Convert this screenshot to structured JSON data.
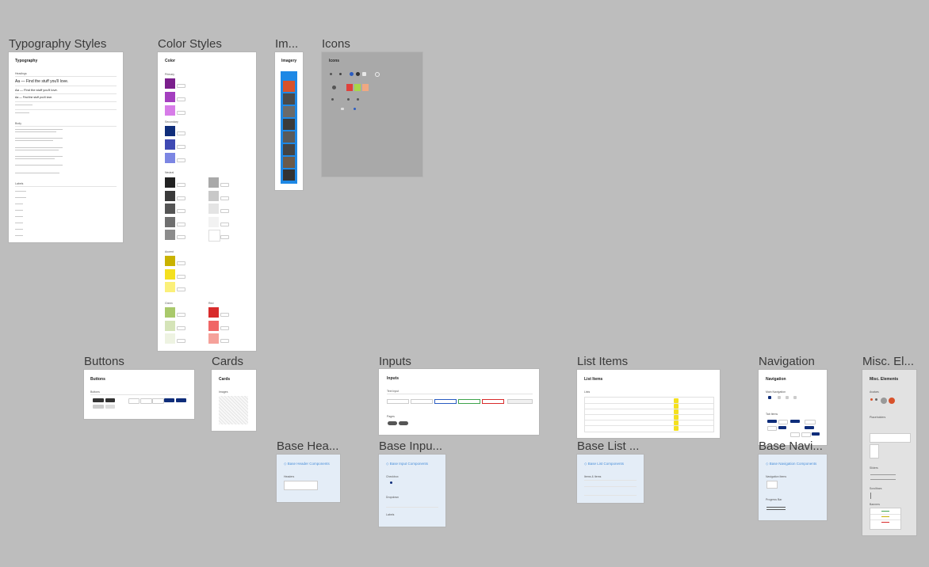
{
  "frames": {
    "typography": {
      "title": "Typography Styles",
      "heading": "Typography",
      "sections": [
        "Headings",
        "Body",
        "Labels"
      ],
      "samples": [
        "Aa — Find the stuff you'll love.",
        "Aa — Find the stuff you'll love.",
        "Aa — Find the stuff you'll love."
      ]
    },
    "color": {
      "title": "Color Styles",
      "heading": "Color",
      "groups": [
        "Primary",
        "Secondary",
        "Neutral",
        "Accent",
        "Green",
        "Red"
      ]
    },
    "imagery": {
      "title": "Im...",
      "heading": "Imagery"
    },
    "icons": {
      "title": "Icons",
      "heading": "Icons"
    },
    "buttons": {
      "title": "Buttons",
      "heading": "Buttons",
      "group": "Buttons"
    },
    "cards": {
      "title": "Cards",
      "heading": "Cards",
      "group": "Images"
    },
    "inputs": {
      "title": "Inputs",
      "heading": "Inputs",
      "group1": "Text Input",
      "group2": "Pages"
    },
    "list_items": {
      "title": "List Items",
      "heading": "List Items",
      "group": "Lists"
    },
    "navigation": {
      "title": "Navigation",
      "heading": "Navigation",
      "group1": "Main Navigation",
      "group2": "Tab Items"
    },
    "misc": {
      "title": "Misc. El...",
      "heading": "Misc. Elements",
      "group1": "Avatars",
      "group2": "Placeholders",
      "group3": "Sliders",
      "group4": "Scrollbars",
      "group5": "Banners"
    },
    "base_header": {
      "title": "Base Hea...",
      "link": "◇ Base Header Components",
      "group": "Headers"
    },
    "base_input": {
      "title": "Base Inpu...",
      "link": "◇ Base Input Components",
      "group1": "Checkbox",
      "group2": "Dropdown",
      "group3": "Labels"
    },
    "base_list": {
      "title": "Base List ...",
      "link": "◇ Base List Components",
      "group": "Items & Items"
    },
    "base_nav": {
      "title": "Base Navi...",
      "link": "◇ Base Navigation Components",
      "group1": "Navigation Items",
      "group2": "Progress Bar"
    }
  },
  "colors": {
    "primary": [
      "#7b1f8c",
      "#a43fbf",
      "#d77ce8"
    ],
    "secondary": [
      "#0f2d7a",
      "#3f4ab3",
      "#7c86e3"
    ],
    "neutral_left": [
      "#222222",
      "#3a3a3a",
      "#555555",
      "#6f6f6f",
      "#8c8c8c"
    ],
    "neutral_right": [
      "#a9a9a9",
      "#c8c8c8",
      "#e4e4e4",
      "#f2f2f2",
      "#ffffff"
    ],
    "accent": [
      "#c9b200",
      "#f4e01f",
      "#fbf07a"
    ],
    "green": [
      "#a9c96b",
      "#d5e4b8",
      "#eef3e2"
    ],
    "red": [
      "#d82b2b",
      "#f06666",
      "#f5a19a"
    ],
    "imagery_frame": "#1e88e5",
    "link_blue": "#4a8fd9",
    "nav_blue": "#0f2d7a"
  },
  "icons": [
    "bell-icon",
    "heart-icon",
    "user-icon",
    "cart-icon",
    "search-icon",
    "plus-icon"
  ]
}
